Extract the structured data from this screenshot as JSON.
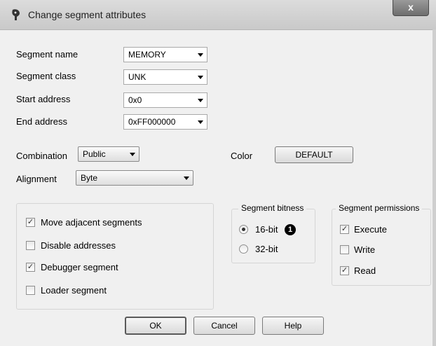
{
  "window": {
    "title": "Change segment attributes",
    "close_label": "x"
  },
  "fields": {
    "segment_name": {
      "label": "Segment name",
      "value": "MEMORY"
    },
    "segment_class": {
      "label": "Segment class",
      "value": "UNK"
    },
    "start_address": {
      "label": "Start address",
      "value": "0x0"
    },
    "end_address": {
      "label": "End address",
      "value": "0xFF000000"
    },
    "combination": {
      "label": "Combination",
      "value": "Public"
    },
    "alignment": {
      "label": "Alignment",
      "value": "Byte"
    },
    "color": {
      "label": "Color",
      "value": "DEFAULT"
    }
  },
  "options": {
    "move_adjacent": {
      "label": "Move adjacent segments",
      "checked": true
    },
    "disable_addresses": {
      "label": "Disable addresses",
      "checked": false
    },
    "debugger_segment": {
      "label": "Debugger segment",
      "checked": true
    },
    "loader_segment": {
      "label": "Loader segment",
      "checked": false
    }
  },
  "bitness": {
    "caption": "Segment bitness",
    "opt16": {
      "label": "16-bit",
      "selected": true
    },
    "opt32": {
      "label": "32-bit",
      "selected": false
    },
    "callout": "1"
  },
  "permissions": {
    "caption": "Segment permissions",
    "execute": {
      "label": "Execute",
      "checked": true
    },
    "write": {
      "label": "Write",
      "checked": false
    },
    "read": {
      "label": "Read",
      "checked": true
    }
  },
  "buttons": {
    "ok": "OK",
    "cancel": "Cancel",
    "help": "Help"
  },
  "check_glyph": "✓"
}
